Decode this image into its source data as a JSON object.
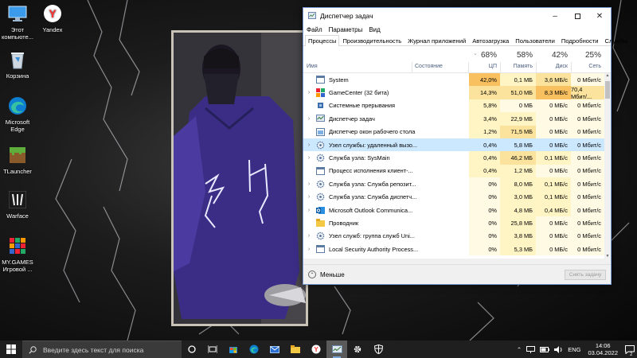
{
  "desktop": {
    "icons": [
      {
        "name": "this-pc",
        "label_lines": [
          "Этот",
          "компьюте..."
        ],
        "icon": "monitor-icon"
      },
      {
        "name": "yandex",
        "label_lines": [
          "Yandex"
        ],
        "icon": "yandex-icon"
      },
      {
        "name": "recycle-bin",
        "label_lines": [
          "Корзина"
        ],
        "icon": "recycle-bin-icon"
      },
      {
        "name": "edge",
        "label_lines": [
          "Microsoft",
          "Edge"
        ],
        "icon": "edge-icon"
      },
      {
        "name": "tlauncher",
        "label_lines": [
          "TLauncher"
        ],
        "icon": "grass-block-icon"
      },
      {
        "name": "warface",
        "label_lines": [
          "Warface"
        ],
        "icon": "warface-icon"
      },
      {
        "name": "mygames",
        "label_lines": [
          "MY.GAMES",
          "Игровой ..."
        ],
        "icon": "mygames-icon"
      }
    ]
  },
  "task_manager": {
    "title": "Диспетчер задач",
    "menu": [
      "Файл",
      "Параметры",
      "Вид"
    ],
    "tabs": [
      "Процессы",
      "Производительность",
      "Журнал приложений",
      "Автозагрузка",
      "Пользователи",
      "Подробности",
      "Службы"
    ],
    "active_tab": 0,
    "columns": {
      "name": "Имя",
      "status": "Состояние",
      "cpu": {
        "pct": "68%",
        "label": "ЦП"
      },
      "memory": {
        "pct": "58%",
        "label": "Память"
      },
      "disk": {
        "pct": "42%",
        "label": "Диск"
      },
      "network": {
        "pct": "25%",
        "label": "Сеть"
      }
    },
    "rows": [
      {
        "name": "System",
        "expand": false,
        "icon": "system-window-icon",
        "cpu": "42,0%",
        "mem": "0,1 МБ",
        "disk": "3,6 МБ/с",
        "net": "0 Мбит/с"
      },
      {
        "name": "GameCenter (32 бита)",
        "expand": true,
        "icon": "gamecenter-icon",
        "cpu": "14,3%",
        "mem": "51,0 МБ",
        "disk": "8,3 МБ/с",
        "net": "70,4 Мбит/..."
      },
      {
        "name": "Системные прерывания",
        "expand": false,
        "icon": "cpu-chip-icon",
        "cpu": "5,8%",
        "mem": "0 МБ",
        "disk": "0 МБ/с",
        "net": "0 Мбит/с"
      },
      {
        "name": "Диспетчер задач",
        "expand": true,
        "icon": "task-manager-icon",
        "cpu": "3,4%",
        "mem": "22,9 МБ",
        "disk": "0 МБ/с",
        "net": "0 Мбит/с"
      },
      {
        "name": "Диспетчер окон рабочего стола",
        "expand": false,
        "icon": "dwm-icon",
        "cpu": "1,2%",
        "mem": "71,5 МБ",
        "disk": "0 МБ/с",
        "net": "0 Мбит/с"
      },
      {
        "name": "Узел службы: удаленный вызо...",
        "expand": true,
        "icon": "service-gear-icon",
        "cpu": "0,4%",
        "mem": "5,8 МБ",
        "disk": "0 МБ/с",
        "net": "0 Мбит/с",
        "selected": true
      },
      {
        "name": "Служба узла: SysMain",
        "expand": true,
        "icon": "service-gear-icon",
        "cpu": "0,4%",
        "mem": "46,2 МБ",
        "disk": "0,1 МБ/с",
        "net": "0 Мбит/с"
      },
      {
        "name": "Процесс исполнения клиент-...",
        "expand": false,
        "icon": "system-window-icon",
        "cpu": "0,4%",
        "mem": "1,2 МБ",
        "disk": "0 МБ/с",
        "net": "0 Мбит/с"
      },
      {
        "name": "Служба узла: Служба репозит...",
        "expand": true,
        "icon": "service-gear-icon",
        "cpu": "0%",
        "mem": "8,0 МБ",
        "disk": "0,1 МБ/с",
        "net": "0 Мбит/с"
      },
      {
        "name": "Служба узла: Служба диспетч...",
        "expand": true,
        "icon": "service-gear-icon",
        "cpu": "0%",
        "mem": "3,0 МБ",
        "disk": "0,1 МБ/с",
        "net": "0 Мбит/с"
      },
      {
        "name": "Microsoft Outlook Communica...",
        "expand": true,
        "icon": "outlook-icon",
        "cpu": "0%",
        "mem": "4,8 МБ",
        "disk": "0,4 МБ/с",
        "net": "0 Мбит/с"
      },
      {
        "name": "Проводник",
        "expand": false,
        "icon": "folder-icon",
        "cpu": "0%",
        "mem": "25,8 МБ",
        "disk": "0 МБ/с",
        "net": "0 Мбит/с"
      },
      {
        "name": "Узел служб: группа служб Uni...",
        "expand": true,
        "icon": "service-gear-icon",
        "cpu": "0%",
        "mem": "3,8 МБ",
        "disk": "0 МБ/с",
        "net": "0 Мбит/с"
      },
      {
        "name": "Local Security Authority Process...",
        "expand": true,
        "icon": "system-window-icon",
        "cpu": "0%",
        "mem": "5,3 МБ",
        "disk": "0 МБ/с",
        "net": "0 Мбит/с"
      }
    ],
    "footer": {
      "less_label": "Меньше",
      "end_task_label": "Снять задачу"
    }
  },
  "taskbar": {
    "search_placeholder": "Введите здесь текст для поиска",
    "tray": {
      "language": "ENG",
      "time": "14:06",
      "date": "03.04.2022",
      "notifications": "2"
    }
  },
  "colors": {
    "cpu_high": "#f9c060",
    "cpu_med": "#fbe39e",
    "heat_light": "#fff4c4",
    "heat_faint": "#fffae3",
    "selection": "#cce8ff",
    "taskbar": "#1f1f1f"
  }
}
